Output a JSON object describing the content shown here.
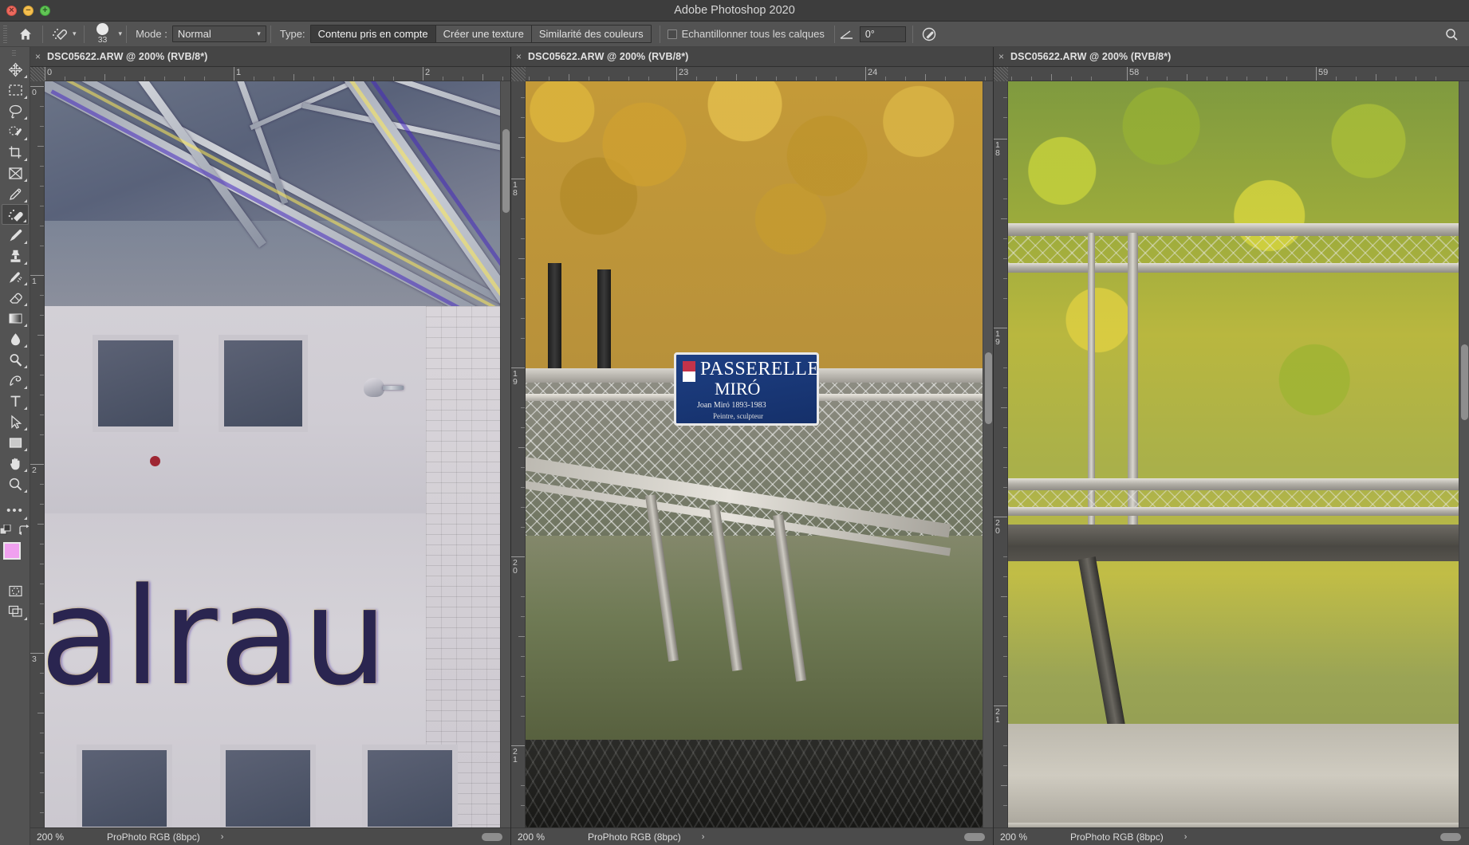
{
  "window": {
    "title": "Adobe Photoshop 2020",
    "traffic_lights": [
      "close",
      "minimize",
      "zoom"
    ]
  },
  "options_bar": {
    "home_icon": "home-icon",
    "tool_icon": "healing-brush-icon",
    "brush_size": "33",
    "mode_label": "Mode :",
    "mode_value": "Normal",
    "type_label": "Type:",
    "type_options": [
      {
        "label": "Contenu pris en compte",
        "active": true
      },
      {
        "label": "Créer une texture",
        "active": false
      },
      {
        "label": "Similarité des couleurs",
        "active": false
      }
    ],
    "sample_all_layers_label": "Echantillonner tous les calques",
    "sample_all_layers_checked": false,
    "angle_icon": "angle-icon",
    "angle_value": "0°",
    "pressure_icon": "pressure-size-icon",
    "search_icon": "search-icon"
  },
  "toolbar": {
    "tools": [
      {
        "name": "move-tool",
        "icon": "move-icon",
        "selected": false
      },
      {
        "name": "marquee-tool",
        "icon": "rectangular-marquee-icon",
        "selected": false
      },
      {
        "name": "lasso-tool",
        "icon": "lasso-icon",
        "selected": false
      },
      {
        "name": "quick-selection-tool",
        "icon": "quick-selection-icon",
        "selected": false
      },
      {
        "name": "crop-tool",
        "icon": "crop-icon",
        "selected": false
      },
      {
        "name": "frame-tool",
        "icon": "frame-icon",
        "selected": false
      },
      {
        "name": "eyedropper-tool",
        "icon": "eyedropper-icon",
        "selected": false
      },
      {
        "name": "healing-brush-tool",
        "icon": "healing-brush-icon",
        "selected": true
      },
      {
        "name": "brush-tool",
        "icon": "brush-icon",
        "selected": false
      },
      {
        "name": "clone-stamp-tool",
        "icon": "clone-stamp-icon",
        "selected": false
      },
      {
        "name": "history-brush-tool",
        "icon": "history-brush-icon",
        "selected": false
      },
      {
        "name": "eraser-tool",
        "icon": "eraser-icon",
        "selected": false
      },
      {
        "name": "gradient-tool",
        "icon": "gradient-icon",
        "selected": false
      },
      {
        "name": "blur-tool",
        "icon": "blur-drop-icon",
        "selected": false
      },
      {
        "name": "dodge-tool",
        "icon": "dodge-icon",
        "selected": false
      },
      {
        "name": "pen-tool",
        "icon": "pen-icon",
        "selected": false
      },
      {
        "name": "type-tool",
        "icon": "type-t-icon",
        "selected": false
      },
      {
        "name": "path-selection-tool",
        "icon": "path-arrow-icon",
        "selected": false
      },
      {
        "name": "rectangle-tool",
        "icon": "rectangle-icon",
        "selected": false
      },
      {
        "name": "hand-tool",
        "icon": "hand-icon",
        "selected": false
      },
      {
        "name": "zoom-tool",
        "icon": "magnifier-icon",
        "selected": false
      },
      {
        "name": "edit-toolbar",
        "icon": "ellipsis-icon",
        "selected": false
      }
    ],
    "swatch_controls": {
      "default-colors-icon": "default-colors-icon",
      "swap-colors-icon": "swap-colors-icon",
      "foreground_color": "#f0a0ef",
      "background_color": "#000000",
      "quick-mask-icon": "quick-mask-icon",
      "screen-mode-icon": "screen-mode-icon"
    }
  },
  "documents": [
    {
      "tab_label": "DSC05622.ARW @ 200% (RVB/8*)",
      "close_icon": "close-icon",
      "ruler_h_labels": [
        "0",
        "1",
        "2"
      ],
      "ruler_v_labels": [
        "0",
        "1",
        "2",
        "3"
      ],
      "zoom": "200 %",
      "color_profile": "ProPhoto RGB (8bpc)",
      "status_arrow": "›"
    },
    {
      "tab_label": "DSC05622.ARW @ 200% (RVB/8*)",
      "close_icon": "close-icon",
      "ruler_h_labels": [
        "23",
        "24"
      ],
      "ruler_v_labels": [
        "18",
        "19",
        "20",
        "21"
      ],
      "zoom": "200 %",
      "color_profile": "ProPhoto RGB (8bpc)",
      "status_arrow": "›"
    },
    {
      "tab_label": "DSC05622.ARW @ 200% (RVB/8*)",
      "close_icon": "close-icon",
      "ruler_h_labels": [
        "58",
        "59"
      ],
      "ruler_v_labels": [
        "18",
        "19",
        "20",
        "21"
      ],
      "zoom": "200 %",
      "color_profile": "ProPhoto RGB (8bpc)",
      "status_arrow": "›"
    }
  ],
  "photos": {
    "photo1": {
      "description": "industrial building facade with steel beams and large letters",
      "letters": "alrau"
    },
    "photo2": {
      "description": "autumn trees behind a footbridge with mesh railing and a blue street sign",
      "sign_line1": "PASSERELLE",
      "sign_line2": "MIRÓ",
      "sign_line3": "Joan Miró 1893-1983",
      "sign_line4": "Peintre, sculpteur"
    },
    "photo3": {
      "description": "yellow-green foliage behind bridge railings and concrete span"
    }
  },
  "colors": {
    "chrome": "#535353",
    "titlebar": "#3d3d3d",
    "tab": "#3c3c3c",
    "ruler": "#4a4a4a",
    "status": "#4b4b4b",
    "accent_selected": "#3b3b3b"
  }
}
